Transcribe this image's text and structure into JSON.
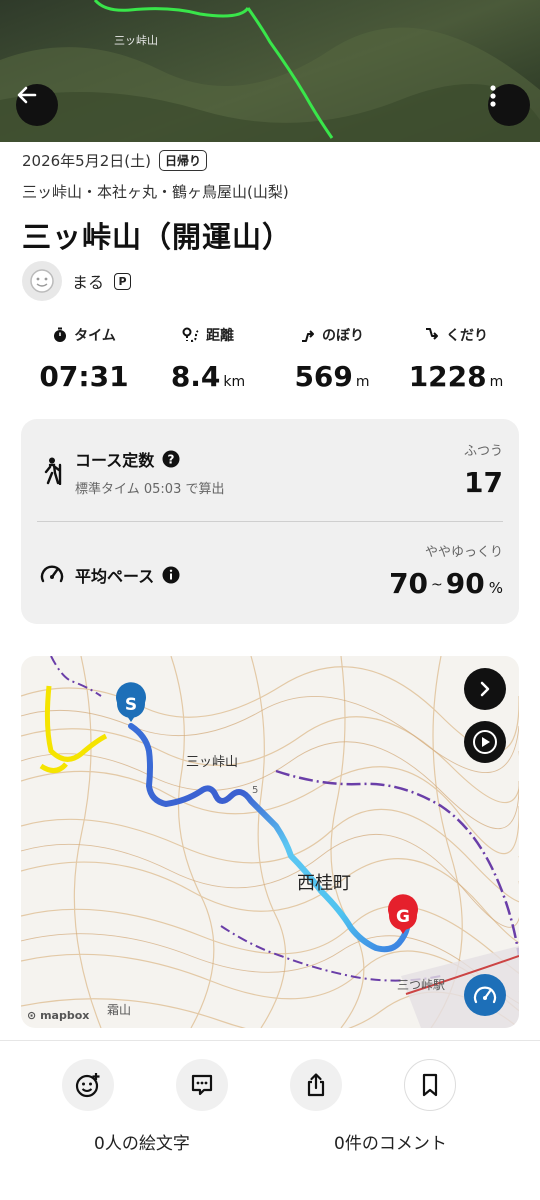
{
  "header": {
    "back_icon": "arrow-left-icon",
    "more_icon": "vertical-dots-icon",
    "photo_caption": "三ッ峠山"
  },
  "activity": {
    "date": "2026年5月2日(土)",
    "trip_badge": "日帰り",
    "mountains": "三ッ峠山・本社ヶ丸・鶴ヶ鳥屋山(山梨)",
    "title": "三ッ峠山（開運山）"
  },
  "user": {
    "name": "まる",
    "premium_badge": "P"
  },
  "stats": {
    "time": {
      "label": "タイム",
      "value": "07:31",
      "unit": ""
    },
    "distance": {
      "label": "距離",
      "value": "8.4",
      "unit": "km"
    },
    "ascent": {
      "label": "のぼり",
      "value": "569",
      "unit": "m"
    },
    "descent": {
      "label": "くだり",
      "value": "1228",
      "unit": "m"
    }
  },
  "course": {
    "label": "コース定数",
    "sub": "標準タイム 05:03 で算出",
    "level": "ふつう",
    "value": "17"
  },
  "pace": {
    "label": "平均ペース",
    "level": "ややゆっくり",
    "low": "70",
    "tilde": "~",
    "high": "90",
    "unit": "%"
  },
  "map": {
    "start_marker": "S",
    "goal_marker": "G",
    "labels": {
      "peak": "三ッ峠山",
      "town": "西桂町",
      "station": "三つ峠駅",
      "south_peak": "霜山",
      "elevation": "5"
    },
    "attribution": "mapbox"
  },
  "actions": {
    "emoji_label": "0人の絵文字",
    "comment_label": "0件のコメント"
  }
}
